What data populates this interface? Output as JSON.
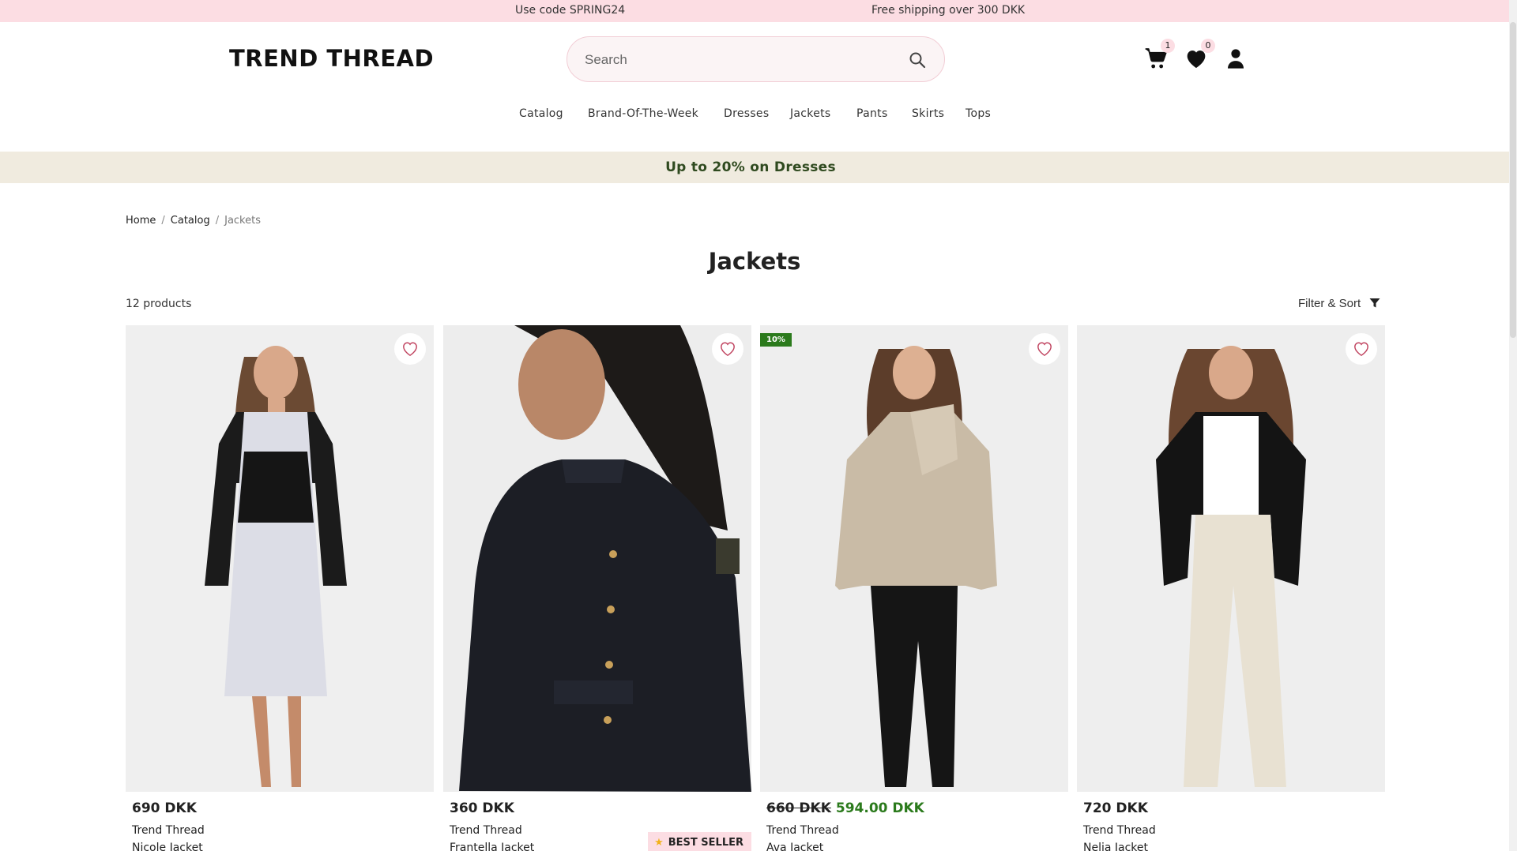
{
  "announcement": {
    "code_text": "Use code SPRING24",
    "shipping_text": "Free shipping over 300 DKK"
  },
  "header": {
    "logo": "TREND THREAD",
    "search_placeholder": "Search",
    "cart_count": "1",
    "wishlist_count": "0"
  },
  "nav": {
    "items": [
      "Catalog",
      "Brand-Of-The-Week",
      "Dresses",
      "Jackets",
      "Pants",
      "Skirts",
      "Tops"
    ]
  },
  "promo": {
    "text": "Up to 20% on Dresses"
  },
  "breadcrumb": {
    "home": "Home",
    "catalog": "Catalog",
    "current": "Jackets"
  },
  "page": {
    "title": "Jackets",
    "product_count": "12 products",
    "filter_label": "Filter & Sort"
  },
  "products": [
    {
      "price": "690 DKK",
      "brand": "Trend Thread",
      "name": "Nicole Jacket"
    },
    {
      "price": "360 DKK",
      "brand": "Trend Thread",
      "name": "Frantella Jacket",
      "badge": "BEST SELLER"
    },
    {
      "old_price": "660 DKK",
      "price": "594.00 DKK",
      "discount": "10%",
      "brand": "Trend Thread",
      "name": "Ava Jacket"
    },
    {
      "price": "720 DKK",
      "brand": "Trend Thread",
      "name": "Nelia Jacket"
    }
  ],
  "colors": {
    "announcement_bg": "#fcdde3",
    "promo_bg": "#f0ebdf",
    "promo_text": "#2f4a1f",
    "sale_green": "#2b7a1c"
  }
}
